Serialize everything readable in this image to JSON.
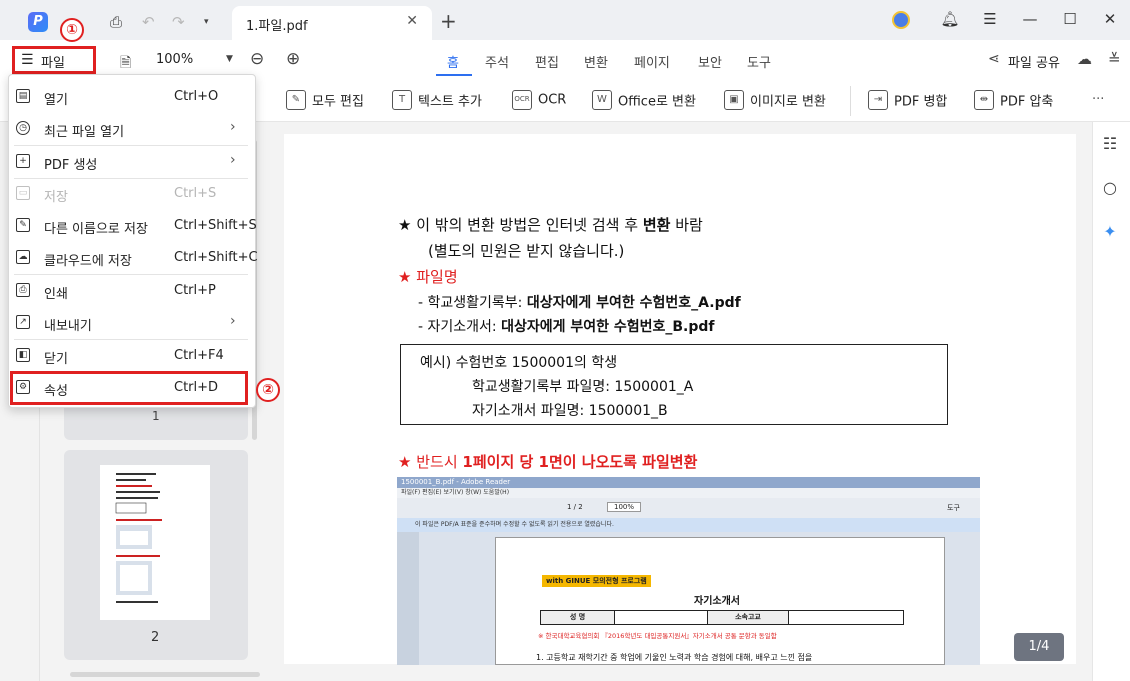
{
  "titlebar": {
    "app_logo": "P",
    "tab_title": "1.파일.pdf",
    "icons": [
      "print-icon",
      "undo-icon",
      "redo-icon",
      "caret-down-icon",
      "close-icon",
      "plus-icon",
      "bell-icon",
      "hamburger-icon",
      "minimize-icon",
      "maximize-icon",
      "window-close-icon"
    ]
  },
  "toolbar": {
    "file_label": "파일",
    "zoom": "100%",
    "tabs": [
      "홈",
      "주석",
      "편집",
      "변환",
      "페이지",
      "보안",
      "도구"
    ],
    "share_label": "파일 공유"
  },
  "ribbon": {
    "items": [
      "모두 편집",
      "텍스트 추가",
      "OCR",
      "Office로 변환",
      "이미지로 변환",
      "PDF 병합",
      "PDF 압축"
    ],
    "more": "···"
  },
  "file_menu": {
    "items": [
      {
        "label": "열기",
        "shortcut": "Ctrl+O"
      },
      {
        "label": "최근 파일 열기",
        "shortcut": ""
      },
      {
        "label": "PDF 생성",
        "shortcut": ""
      },
      {
        "label": "저장",
        "shortcut": "Ctrl+S"
      },
      {
        "label": "다른 이름으로 저장",
        "shortcut": "Ctrl+Shift+S"
      },
      {
        "label": "클라우드에 저장",
        "shortcut": "Ctrl+Shift+C"
      },
      {
        "label": "인쇄",
        "shortcut": "Ctrl+P"
      },
      {
        "label": "내보내기",
        "shortcut": ""
      },
      {
        "label": "닫기",
        "shortcut": "Ctrl+F4"
      },
      {
        "label": "속성",
        "shortcut": "Ctrl+D"
      }
    ]
  },
  "annotations": {
    "step1": "①",
    "step2": "②"
  },
  "thumbnails": {
    "page1": "1",
    "page2": "2"
  },
  "document": {
    "line1_a": "이 밖의 변환 방법은 인터넷 검색 후",
    "line1_b": "변환",
    "line1_c": "바람",
    "line2": "(별도의 민원은 받지 않습니다.)",
    "heading1": "파일명",
    "item1_label": "- 학교생활기록부:",
    "item1_value": "대상자에게 부여한 수험번호_A.pdf",
    "item2_label": "- 자기소개서:",
    "item2_value": "대상자에게 부여한 수험번호_B.pdf",
    "example1": "예시) 수험번호 1500001의 학생",
    "example2": "학교생활기록부 파일명: 1500001_A",
    "example3": "자기소개서 파일명: 1500001_B",
    "heading2_a": "반드시",
    "heading2_b": "1페이지 당 1면이 나오도록 파일변환",
    "star": "★"
  },
  "embedded_shot": {
    "title": "1500001_B.pdf - Adobe Reader",
    "menu": "파일(F)  편집(E)  보기(V)  창(W)  도움말(H)",
    "info": "이 파일은 PDF/A 표준을 준수하며 수정할 수 없도록 읽기 전용으로 열렸습니다.",
    "zoom": "100%",
    "page": "1 / 2",
    "tools": "도구",
    "badge": "with GINUE 모의전형 프로그램",
    "doc_title": "자기소개서",
    "col1": "성     명",
    "col2": "소속고교",
    "note": "※ 한국대학교육협의회 『2016학년도 대입공통지원서』자기소개서 공통 문항과 동일함",
    "text": "1. 고등학교 재학기간 중 학업에 기울인 노력과 학습 경험에 대해, 배우고 느낀 점을"
  },
  "page_indicator": "1/4"
}
